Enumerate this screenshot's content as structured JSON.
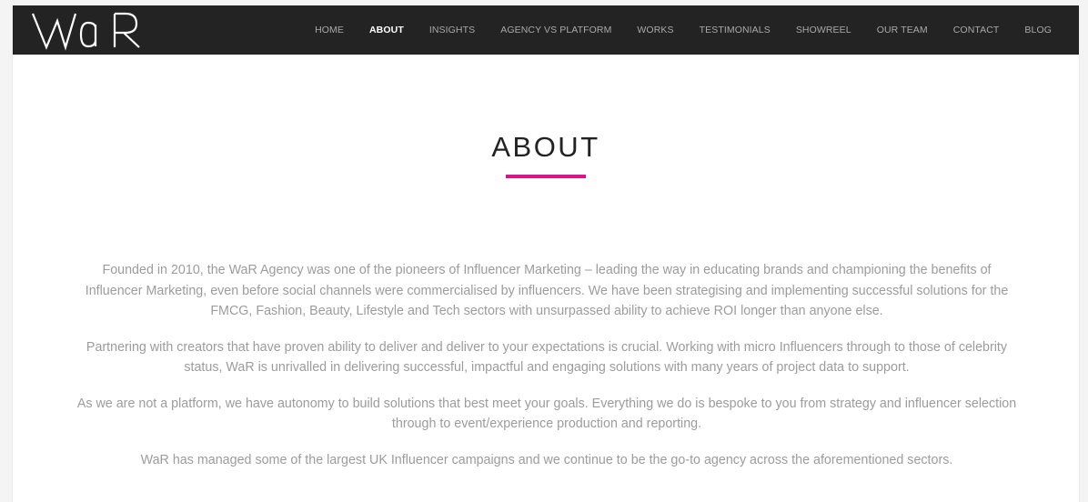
{
  "brand": {
    "logo_text": "WaR",
    "accent_color": "#d9158a"
  },
  "nav": {
    "items": [
      {
        "label": "HOME"
      },
      {
        "label": "ABOUT",
        "active": true
      },
      {
        "label": "INSIGHTS"
      },
      {
        "label": "AGENCY VS PLATFORM"
      },
      {
        "label": "WORKS"
      },
      {
        "label": "TESTIMONIALS"
      },
      {
        "label": "SHOWREEL"
      },
      {
        "label": "OUR TEAM"
      },
      {
        "label": "CONTACT"
      },
      {
        "label": "BLOG"
      }
    ]
  },
  "about": {
    "title": "ABOUT",
    "paragraphs": [
      "Founded in 2010, the WaR Agency was one of the pioneers of Influencer Marketing – leading the way in educating brands and championing the benefits of Influencer Marketing, even before social channels were commercialised by influencers. We have been strategising and implementing successful solutions for the FMCG, Fashion, Beauty, Lifestyle and Tech sectors with unsurpassed ability to achieve ROI longer than anyone else.",
      "Partnering with creators that have proven ability to deliver and deliver to your expectations is crucial. Working with micro Influencers through to those of celebrity status, WaR is unrivalled in delivering successful, impactful and engaging solutions with many years of project data to support.",
      "As we are not a platform, we have autonomy to build solutions that best meet your goals. Everything we do is bespoke to you from strategy and influencer selection through to event/experience production and reporting.",
      "WaR has managed some of the largest UK Influencer campaigns and we continue to be the go-to agency across the aforementioned sectors."
    ]
  }
}
